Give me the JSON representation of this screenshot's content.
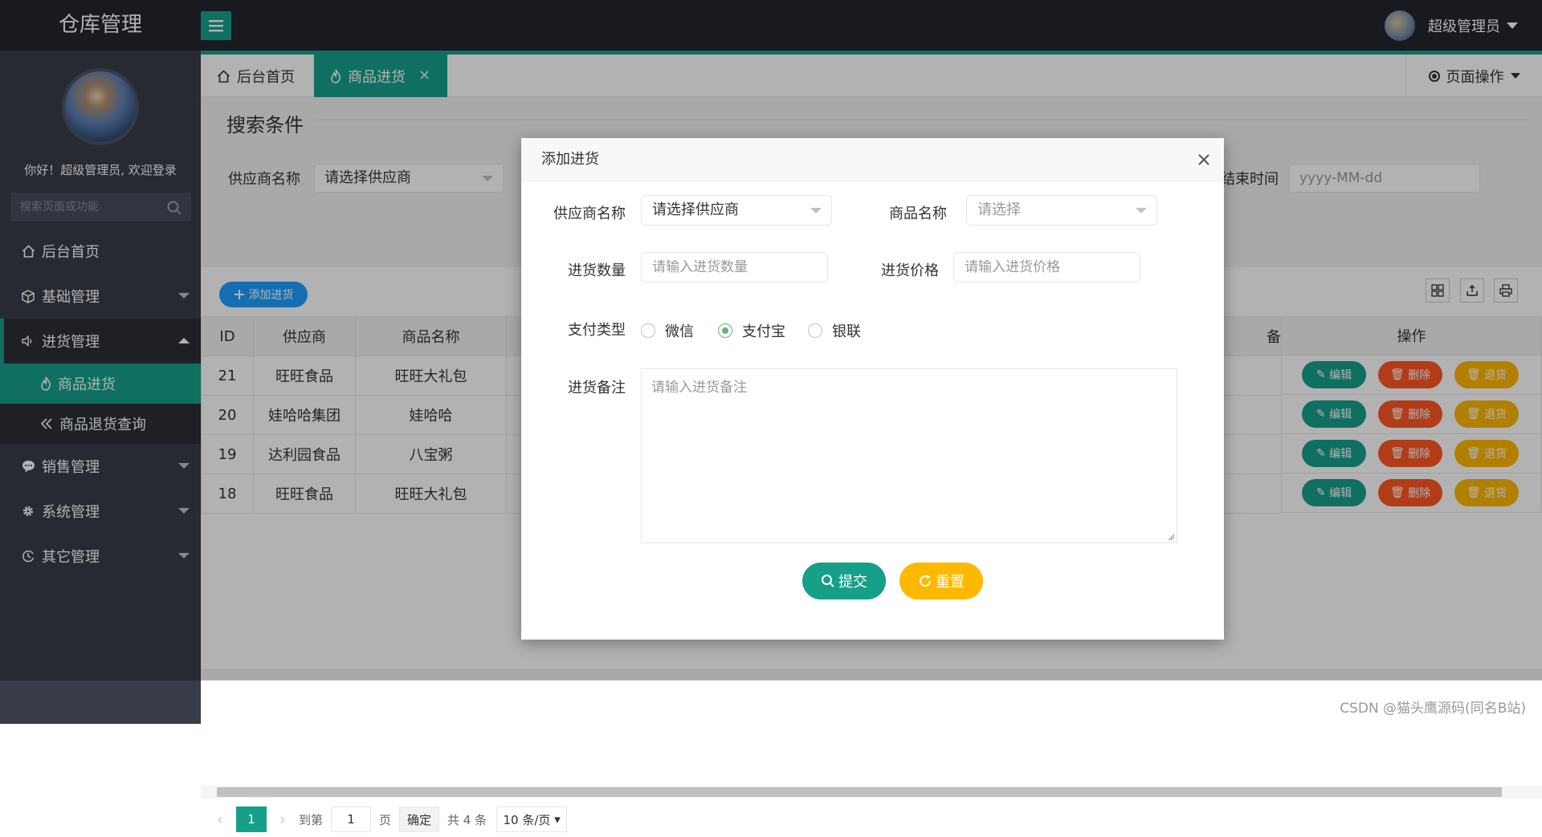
{
  "header": {
    "logo": "仓库管理",
    "user_name": "超级管理员"
  },
  "sidebar": {
    "welcome": "你好！超级管理员, 欢迎登录",
    "search_placeholder": "搜索页面或功能",
    "items": [
      {
        "label": "后台首页",
        "icon": "home-icon"
      },
      {
        "label": "基础管理",
        "icon": "cube-icon"
      },
      {
        "label": "进货管理",
        "icon": "speaker-icon"
      },
      {
        "label": "销售管理",
        "icon": "chat-icon"
      },
      {
        "label": "系统管理",
        "icon": "gear-icon"
      },
      {
        "label": "其它管理",
        "icon": "clock-icon"
      }
    ],
    "sub_items": [
      {
        "label": "商品进货",
        "icon": "fire-icon"
      },
      {
        "label": "商品退货查询",
        "icon": "double-chevron-left-icon"
      }
    ]
  },
  "tabs": {
    "home": "后台首页",
    "current": "商品进货",
    "page_op": "页面操作"
  },
  "search_form": {
    "legend": "搜索条件",
    "supplier_label": "供应商名称",
    "supplier_value": "请选择供应商",
    "end_time_label": "结束时间",
    "end_time_placeholder": "yyyy-MM-dd"
  },
  "table": {
    "add_button": "添加进货",
    "columns": [
      "ID",
      "供应商",
      "商品名称"
    ],
    "col_partial": "备",
    "op_header": "操作",
    "rows": [
      {
        "id": "21",
        "supplier": "旺旺食品",
        "goods": "旺旺大礼包"
      },
      {
        "id": "20",
        "supplier": "娃哈哈集团",
        "goods": "娃哈哈"
      },
      {
        "id": "19",
        "supplier": "达利园食品",
        "goods": "八宝粥"
      },
      {
        "id": "18",
        "supplier": "旺旺食品",
        "goods": "旺旺大礼包"
      }
    ],
    "edit_label": "编辑",
    "delete_label": "删除",
    "return_label": "退货"
  },
  "pager": {
    "current_page": "1",
    "goto_label": "到第",
    "goto_value": "1",
    "page_unit": "页",
    "confirm": "确定",
    "total": "共 4 条",
    "per_page": "10 条/页"
  },
  "modal": {
    "title": "添加进货",
    "supplier_label": "供应商名称",
    "supplier_value": "请选择供应商",
    "goods_label": "商品名称",
    "goods_placeholder": "请选择",
    "qty_label": "进货数量",
    "qty_placeholder": "请输入进货数量",
    "price_label": "进货价格",
    "price_placeholder": "请输入进货价格",
    "pay_label": "支付类型",
    "pay_options": [
      "微信",
      "支付宝",
      "银联"
    ],
    "pay_selected": "支付宝",
    "remark_label": "进货备注",
    "remark_placeholder": "请输入进货备注",
    "submit": "提交",
    "reset": "重置"
  },
  "footer_note": "CSDN @猫头鹰源码(同名B站)",
  "colors": {
    "accent": "#16a08a",
    "header_bg": "#23262e",
    "sidebar_bg": "#393d49",
    "danger": "#ff5722",
    "warn": "#ffb800",
    "blue": "#1e9fff"
  }
}
